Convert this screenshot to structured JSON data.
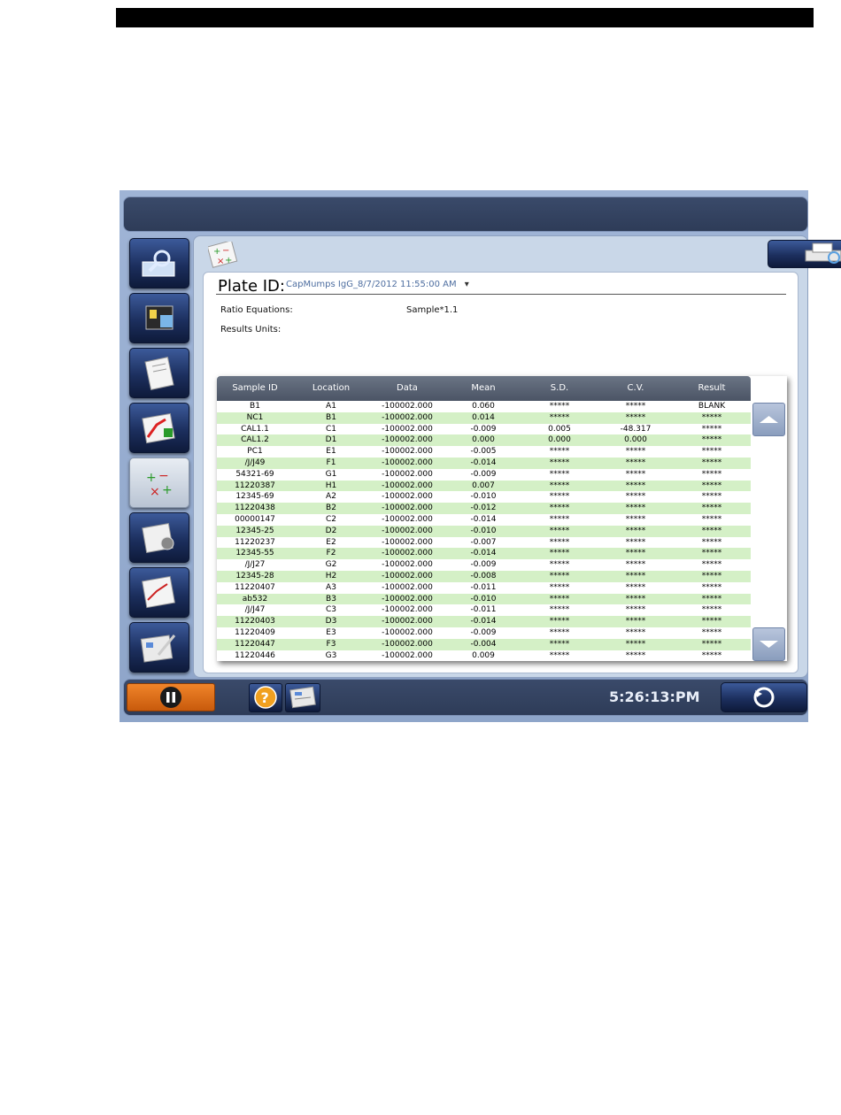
{
  "plate": {
    "label": "Plate ID:",
    "value": "CapMumps IgG_8/7/2012 11:55:00 AM",
    "dropdown_glyph": "▾"
  },
  "ratio": {
    "label": "Ratio Equations:",
    "value": "Sample*1.1"
  },
  "units": {
    "label": "Results Units:"
  },
  "table": {
    "headers": [
      "Sample ID",
      "Location",
      "Data",
      "Mean",
      "S.D.",
      "C.V.",
      "Result"
    ],
    "rows": [
      [
        "B1",
        "A1",
        "-100002.000",
        "0.060",
        "*****",
        "*****",
        "BLANK"
      ],
      [
        "NC1",
        "B1",
        "-100002.000",
        "0.014",
        "*****",
        "*****",
        "*****"
      ],
      [
        "CAL1.1",
        "C1",
        "-100002.000",
        "-0.009",
        "0.005",
        "-48.317",
        "*****"
      ],
      [
        "CAL1.2",
        "D1",
        "-100002.000",
        "0.000",
        "0.000",
        "0.000",
        "*****"
      ],
      [
        "PC1",
        "E1",
        "-100002.000",
        "-0.005",
        "*****",
        "*****",
        "*****"
      ],
      [
        "/J/J49",
        "F1",
        "-100002.000",
        "-0.014",
        "*****",
        "*****",
        "*****"
      ],
      [
        "54321-69",
        "G1",
        "-100002.000",
        "-0.009",
        "*****",
        "*****",
        "*****"
      ],
      [
        "11220387",
        "H1",
        "-100002.000",
        "0.007",
        "*****",
        "*****",
        "*****"
      ],
      [
        "12345-69",
        "A2",
        "-100002.000",
        "-0.010",
        "*****",
        "*****",
        "*****"
      ],
      [
        "11220438",
        "B2",
        "-100002.000",
        "-0.012",
        "*****",
        "*****",
        "*****"
      ],
      [
        "00000147",
        "C2",
        "-100002.000",
        "-0.014",
        "*****",
        "*****",
        "*****"
      ],
      [
        "12345-25",
        "D2",
        "-100002.000",
        "-0.010",
        "*****",
        "*****",
        "*****"
      ],
      [
        "11220237",
        "E2",
        "-100002.000",
        "-0.007",
        "*****",
        "*****",
        "*****"
      ],
      [
        "12345-55",
        "F2",
        "-100002.000",
        "-0.014",
        "*****",
        "*****",
        "*****"
      ],
      [
        "/J/J27",
        "G2",
        "-100002.000",
        "-0.009",
        "*****",
        "*****",
        "*****"
      ],
      [
        "12345-28",
        "H2",
        "-100002.000",
        "-0.008",
        "*****",
        "*****",
        "*****"
      ],
      [
        "11220407",
        "A3",
        "-100002.000",
        "-0.011",
        "*****",
        "*****",
        "*****"
      ],
      [
        "ab532",
        "B3",
        "-100002.000",
        "-0.010",
        "*****",
        "*****",
        "*****"
      ],
      [
        "/J/J47",
        "C3",
        "-100002.000",
        "-0.011",
        "*****",
        "*****",
        "*****"
      ],
      [
        "11220403",
        "D3",
        "-100002.000",
        "-0.014",
        "*****",
        "*****",
        "*****"
      ],
      [
        "11220409",
        "E3",
        "-100002.000",
        "-0.009",
        "*****",
        "*****",
        "*****"
      ],
      [
        "11220447",
        "F3",
        "-100002.000",
        "-0.004",
        "*****",
        "*****",
        "*****"
      ],
      [
        "11220446",
        "G3",
        "-100002.000",
        "0.009",
        "*****",
        "*****",
        "*****"
      ]
    ]
  },
  "footer": {
    "clock": "5:26:13:PM"
  },
  "colors": {
    "row_alt": "#d4f0c6",
    "header_bar": "#2e3c58",
    "pause_button": "#e06a16"
  },
  "icons": {
    "sidebar": [
      "magnifier-plate-icon",
      "reader-instrument-icon",
      "clipboard-icon",
      "curve-edit-icon",
      "calculation-icon",
      "settings-grid-icon",
      "graph-icon",
      "report-icon"
    ],
    "print": "printer-icon",
    "help": "help-icon",
    "notes": "notes-icon",
    "pause": "pause-icon",
    "back": "back-arrow-icon",
    "scroll_up": "chevron-up-icon",
    "scroll_down": "chevron-down-icon"
  }
}
